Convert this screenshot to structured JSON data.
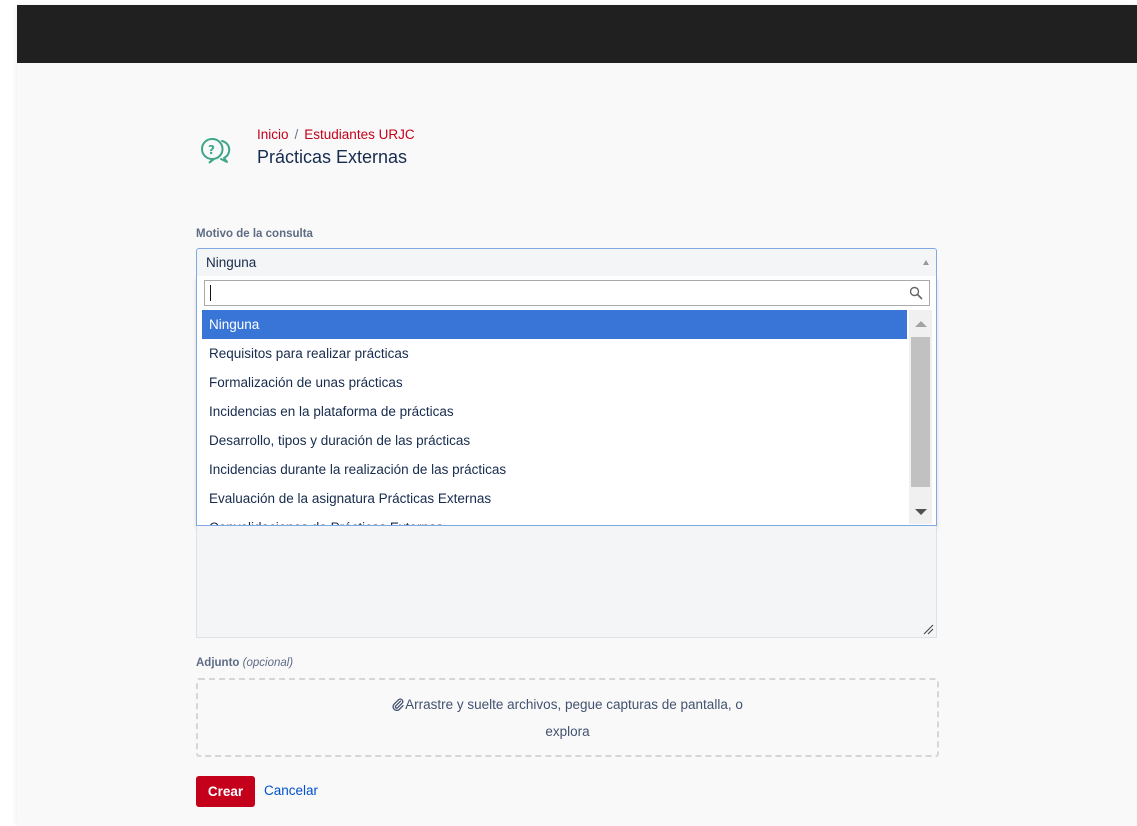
{
  "breadcrumb": {
    "home": "Inicio",
    "separator": "/",
    "section": "Estudiantes URJC"
  },
  "page": {
    "title": "Prácticas Externas",
    "icon": "help-chat-icon"
  },
  "form": {
    "reason_label": "Motivo de la consulta",
    "reason_value": "Ninguna",
    "search_value": "",
    "options": [
      "Ninguna",
      "Requisitos para realizar prácticas",
      "Formalización de unas prácticas",
      "Incidencias en la plataforma de prácticas",
      "Desarrollo, tipos y duración de las prácticas",
      "Incidencias durante la realización de las prácticas",
      "Evaluación de la asignatura Prácticas Externas",
      "Convalidaciones de Prácticas Externas"
    ],
    "selected_index": 0,
    "attachment_label": "Adjunto",
    "attachment_optional": "(opcional)",
    "dropzone_text": "Arrastre y suelte archivos, pegue capturas de pantalla, o",
    "dropzone_link": "explora",
    "create_label": "Crear",
    "cancel_label": "Cancelar"
  },
  "colors": {
    "accent": "#c4001a",
    "selected": "#3875d7",
    "link": "#0052cc",
    "topbar": "#202020",
    "icon_green": "#3fa68a"
  }
}
